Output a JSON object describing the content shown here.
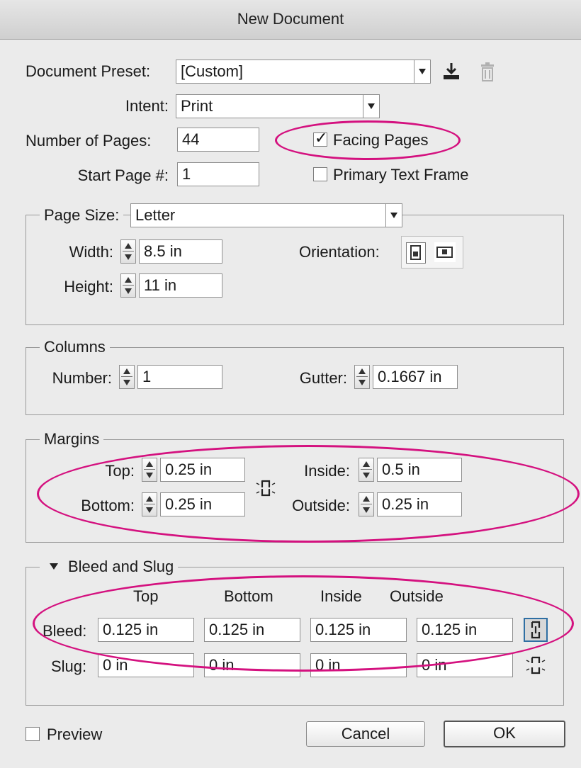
{
  "window": {
    "title": "New Document"
  },
  "document_preset": {
    "label": "Document Preset:",
    "value": "[Custom]"
  },
  "intent": {
    "label": "Intent:",
    "value": "Print"
  },
  "pages": {
    "number_label": "Number of Pages:",
    "number_value": "44",
    "start_label": "Start Page #:",
    "start_value": "1",
    "facing_pages_label": "Facing Pages",
    "facing_pages_checked": true,
    "primary_text_frame_label": "Primary Text Frame",
    "primary_text_frame_checked": false
  },
  "page_size": {
    "label": "Page Size:",
    "value": "Letter",
    "width_label": "Width:",
    "width_value": "8.5 in",
    "height_label": "Height:",
    "height_value": "11 in",
    "orientation_label": "Orientation:"
  },
  "columns": {
    "legend": "Columns",
    "number_label": "Number:",
    "number_value": "1",
    "gutter_label": "Gutter:",
    "gutter_value": "0.1667 in"
  },
  "margins": {
    "legend": "Margins",
    "top_label": "Top:",
    "top_value": "0.25 in",
    "bottom_label": "Bottom:",
    "bottom_value": "0.25 in",
    "inside_label": "Inside:",
    "inside_value": "0.5 in",
    "outside_label": "Outside:",
    "outside_value": "0.25 in"
  },
  "bleed_slug": {
    "legend": "Bleed and Slug",
    "columns": [
      "Top",
      "Bottom",
      "Inside",
      "Outside"
    ],
    "bleed_label": "Bleed:",
    "bleed_values": [
      "0.125 in",
      "0.125 in",
      "0.125 in",
      "0.125 in"
    ],
    "slug_label": "Slug:",
    "slug_values": [
      "0 in",
      "0 in",
      "0 in",
      "0 in"
    ]
  },
  "footer": {
    "preview_label": "Preview",
    "preview_checked": false,
    "cancel_label": "Cancel",
    "ok_label": "OK"
  },
  "annotation_color": "#d4117f"
}
